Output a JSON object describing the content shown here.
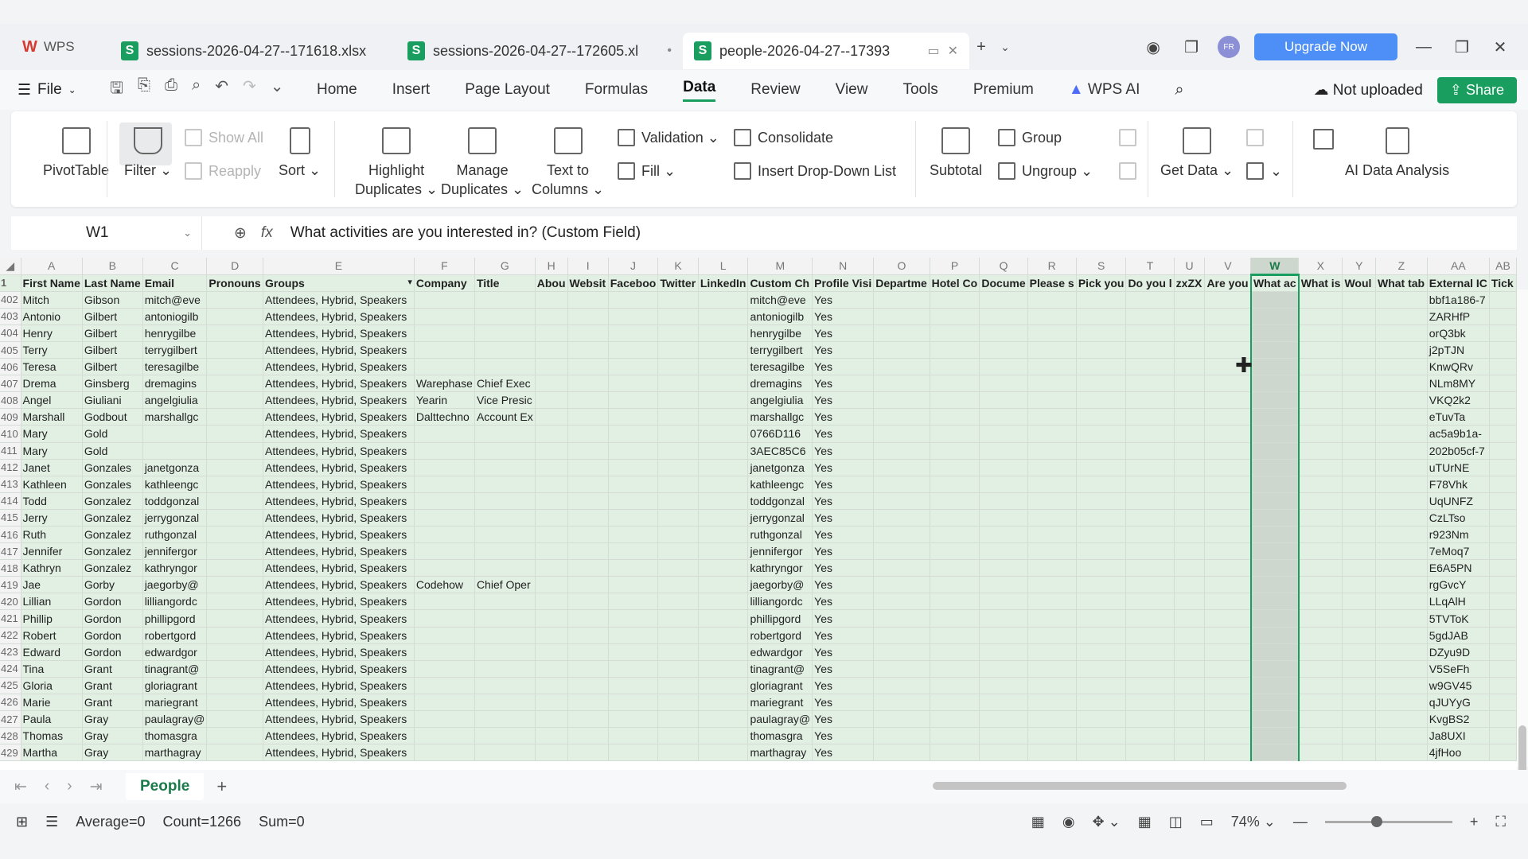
{
  "titlebar": {
    "app_name": "WPS",
    "tabs": [
      {
        "title": "sessions-2026-04-27--171618.xlsx",
        "active": false
      },
      {
        "title": "sessions-2026-04-27--172605.xl",
        "active": false
      },
      {
        "title": "people-2026-04-27--17393",
        "active": true
      }
    ],
    "upgrade": "Upgrade Now"
  },
  "menu": {
    "file": "File",
    "items": [
      "Home",
      "Insert",
      "Page Layout",
      "Formulas",
      "Data",
      "Review",
      "View",
      "Tools",
      "Premium"
    ],
    "active": "Data",
    "wps_ai": "WPS AI",
    "not_uploaded": "Not uploaded",
    "share": "Share"
  },
  "ribbon": {
    "pivot": "PivotTable",
    "filter": "Filter",
    "show_all": "Show All",
    "reapply": "Reapply",
    "sort": "Sort",
    "highlight1": "Highlight",
    "highlight2": "Duplicates",
    "manage1": "Manage",
    "manage2": "Duplicates",
    "ttc1": "Text to",
    "ttc2": "Columns",
    "validation": "Validation",
    "fill": "Fill",
    "consolidate": "Consolidate",
    "dropdown": "Insert Drop-Down List",
    "subtotal": "Subtotal",
    "group": "Group",
    "ungroup": "Ungroup",
    "getdata": "Get Data",
    "ai": "AI Data Analysis"
  },
  "formula": {
    "cell": "W1",
    "content": "What activities are you interested in? (Custom Field)"
  },
  "grid": {
    "columns": [
      "A",
      "B",
      "C",
      "D",
      "E",
      "F",
      "G",
      "H",
      "I",
      "J",
      "K",
      "L",
      "M",
      "N",
      "O",
      "P",
      "Q",
      "R",
      "S",
      "T",
      "U",
      "V",
      "W",
      "X",
      "Y",
      "Z",
      "AA",
      "AB"
    ],
    "headers": [
      "First Name",
      "Last Name",
      "Email",
      "Pronouns",
      "Groups",
      "Company",
      "Title",
      "Abou",
      "Websit",
      "Faceboo",
      "Twitter",
      "LinkedIn",
      "Custom Ch",
      "Profile Visi",
      "Departme",
      "Hotel Co",
      "Docume",
      "Please s",
      "Pick you",
      "Do you l",
      "zxZX",
      "Are you",
      "What ac",
      "What is",
      "Woul",
      "What tab",
      "External IC",
      "Tick"
    ],
    "rows": [
      {
        "n": "402",
        "first": "Mitch",
        "last": "Gibson",
        "email": "mitch@eve",
        "company": "",
        "title": "",
        "custom": "mitch@eve",
        "profile": "Yes",
        "ext": "bbf1a186-7"
      },
      {
        "n": "403",
        "first": "Antonio",
        "last": "Gilbert",
        "email": "antoniogilb",
        "company": "",
        "title": "",
        "custom": "antoniogilb",
        "profile": "Yes",
        "ext": "ZARHfP"
      },
      {
        "n": "404",
        "first": "Henry",
        "last": "Gilbert",
        "email": "henrygilbe",
        "company": "",
        "title": "",
        "custom": "henrygilbe",
        "profile": "Yes",
        "ext": "orQ3bk"
      },
      {
        "n": "405",
        "first": "Terry",
        "last": "Gilbert",
        "email": "terrygilbert",
        "company": "",
        "title": "",
        "custom": "terrygilbert",
        "profile": "Yes",
        "ext": "j2pTJN"
      },
      {
        "n": "406",
        "first": "Teresa",
        "last": "Gilbert",
        "email": "teresagilbe",
        "company": "",
        "title": "",
        "custom": "teresagilbe",
        "profile": "Yes",
        "ext": "KnwQRv"
      },
      {
        "n": "407",
        "first": "Drema",
        "last": "Ginsberg",
        "email": "dremagins",
        "company": "Warephase",
        "title": "Chief Exec",
        "custom": "dremagins",
        "profile": "Yes",
        "ext": "NLm8MY"
      },
      {
        "n": "408",
        "first": "Angel",
        "last": "Giuliani",
        "email": "angelgiulia",
        "company": "Yearin",
        "title": "Vice Presic",
        "custom": "angelgiulia",
        "profile": "Yes",
        "ext": "VKQ2k2"
      },
      {
        "n": "409",
        "first": "Marshall",
        "last": "Godbout",
        "email": "marshallgc",
        "company": "Dalttechno",
        "title": "Account Ex",
        "custom": "marshallgc",
        "profile": "Yes",
        "ext": "eTuvTa"
      },
      {
        "n": "410",
        "first": "Mary",
        "last": "Gold",
        "email": "",
        "company": "",
        "title": "",
        "custom": "0766D116",
        "profile": "Yes",
        "ext": "ac5a9b1a-"
      },
      {
        "n": "411",
        "first": "Mary",
        "last": "Gold",
        "email": "",
        "company": "",
        "title": "",
        "custom": "3AEC85C6",
        "profile": "Yes",
        "ext": "202b05cf-7"
      },
      {
        "n": "412",
        "first": "Janet",
        "last": "Gonzales",
        "email": "janetgonza",
        "company": "",
        "title": "",
        "custom": "janetgonza",
        "profile": "Yes",
        "ext": "uTUrNE"
      },
      {
        "n": "413",
        "first": "Kathleen",
        "last": "Gonzales",
        "email": "kathleengc",
        "company": "",
        "title": "",
        "custom": "kathleengc",
        "profile": "Yes",
        "ext": "F78Vhk"
      },
      {
        "n": "414",
        "first": "Todd",
        "last": "Gonzalez",
        "email": "toddgonzal",
        "company": "",
        "title": "",
        "custom": "toddgonzal",
        "profile": "Yes",
        "ext": "UqUNFZ"
      },
      {
        "n": "415",
        "first": "Jerry",
        "last": "Gonzalez",
        "email": "jerrygonzal",
        "company": "",
        "title": "",
        "custom": "jerrygonzal",
        "profile": "Yes",
        "ext": "CzLTso"
      },
      {
        "n": "416",
        "first": "Ruth",
        "last": "Gonzalez",
        "email": "ruthgonzal",
        "company": "",
        "title": "",
        "custom": "ruthgonzal",
        "profile": "Yes",
        "ext": "r923Nm"
      },
      {
        "n": "417",
        "first": "Jennifer",
        "last": "Gonzalez",
        "email": "jennifergor",
        "company": "",
        "title": "",
        "custom": "jennifergor",
        "profile": "Yes",
        "ext": "7eMoq7"
      },
      {
        "n": "418",
        "first": "Kathryn",
        "last": "Gonzalez",
        "email": "kathryngor",
        "company": "",
        "title": "",
        "custom": "kathryngor",
        "profile": "Yes",
        "ext": "E6A5PN"
      },
      {
        "n": "419",
        "first": "Jae",
        "last": "Gorby",
        "email": "jaegorby@",
        "company": "Codehow",
        "title": "Chief Oper",
        "custom": "jaegorby@",
        "profile": "Yes",
        "ext": "rgGvcY"
      },
      {
        "n": "420",
        "first": "Lillian",
        "last": "Gordon",
        "email": "lilliangordc",
        "company": "",
        "title": "",
        "custom": "lilliangordc",
        "profile": "Yes",
        "ext": "LLqAlH"
      },
      {
        "n": "421",
        "first": "Phillip",
        "last": "Gordon",
        "email": "phillipgord",
        "company": "",
        "title": "",
        "custom": "phillipgord",
        "profile": "Yes",
        "ext": "5TVToK"
      },
      {
        "n": "422",
        "first": "Robert",
        "last": "Gordon",
        "email": "robertgord",
        "company": "",
        "title": "",
        "custom": "robertgord",
        "profile": "Yes",
        "ext": "5gdJAB"
      },
      {
        "n": "423",
        "first": "Edward",
        "last": "Gordon",
        "email": "edwardgor",
        "company": "",
        "title": "",
        "custom": "edwardgor",
        "profile": "Yes",
        "ext": "DZyu9D"
      },
      {
        "n": "424",
        "first": "Tina",
        "last": "Grant",
        "email": "tinagrant@",
        "company": "",
        "title": "",
        "custom": "tinagrant@",
        "profile": "Yes",
        "ext": "V5SeFh"
      },
      {
        "n": "425",
        "first": "Gloria",
        "last": "Grant",
        "email": "gloriagrant",
        "company": "",
        "title": "",
        "custom": "gloriagrant",
        "profile": "Yes",
        "ext": "w9GV45"
      },
      {
        "n": "426",
        "first": "Marie",
        "last": "Grant",
        "email": "mariegrant",
        "company": "",
        "title": "",
        "custom": "mariegrant",
        "profile": "Yes",
        "ext": "qJUYyG"
      },
      {
        "n": "427",
        "first": "Paula",
        "last": "Gray",
        "email": "paulagray@",
        "company": "",
        "title": "",
        "custom": "paulagray@",
        "profile": "Yes",
        "ext": "KvgBS2"
      },
      {
        "n": "428",
        "first": "Thomas",
        "last": "Gray",
        "email": "thomasgra",
        "company": "",
        "title": "",
        "custom": "thomasgra",
        "profile": "Yes",
        "ext": "Ja8UXI"
      },
      {
        "n": "429",
        "first": "Martha",
        "last": "Gray",
        "email": "marthagray",
        "company": "",
        "title": "",
        "custom": "marthagray",
        "profile": "Yes",
        "ext": "4jfHoo"
      }
    ],
    "groups_value": "Attendees, Hybrid, Speakers"
  },
  "sheet": {
    "name": "People"
  },
  "status": {
    "average": "Average=0",
    "count": "Count=1266",
    "sum": "Sum=0",
    "zoom": "74%"
  },
  "colors": {
    "accent": "#1a9e5f",
    "selection": "#e2efe3",
    "upgrade": "#4d8ff7"
  }
}
